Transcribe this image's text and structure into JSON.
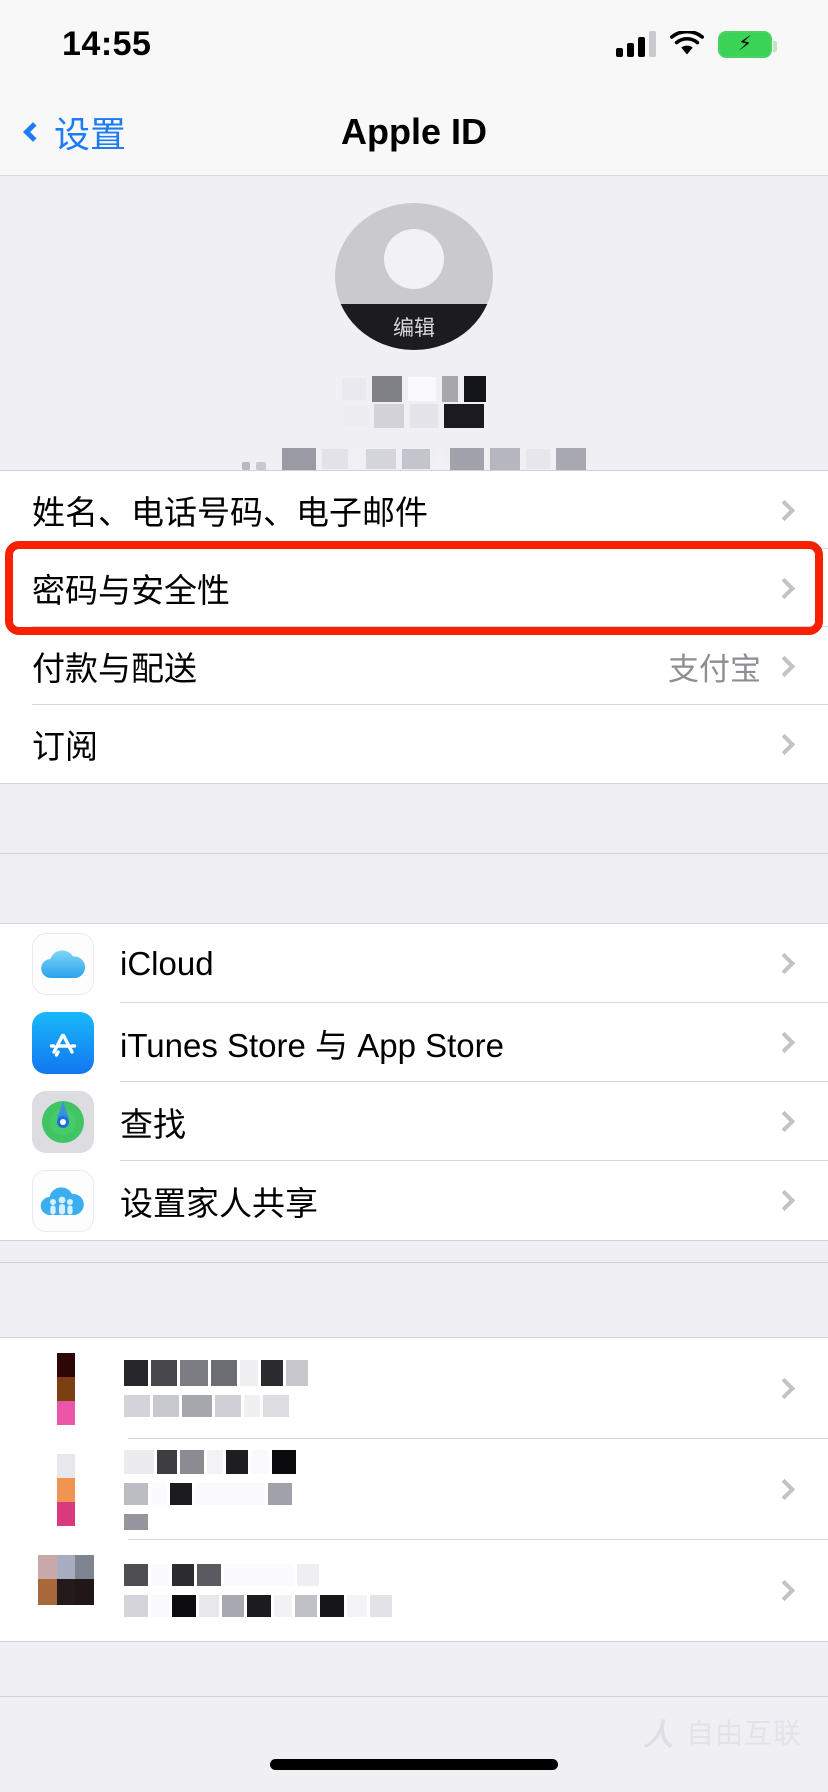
{
  "status_bar": {
    "time": "14:55",
    "signal_icon": "cellular-signal-icon",
    "signal_bars_filled": 3,
    "signal_bars_total": 4,
    "wifi_icon": "wifi-icon",
    "battery_icon": "battery-charging-icon",
    "battery_charging": true,
    "battery_color": "#3ad355",
    "bolt_glyph": "⚡"
  },
  "nav": {
    "back_label": "设置",
    "back_icon": "chevron-left-icon",
    "title": "Apple ID",
    "tint_color": "#1d7cf2"
  },
  "profile": {
    "avatar_icon": "person-placeholder-avatar",
    "edit_label": "编辑",
    "name_redacted": true,
    "email_redacted": true
  },
  "account_group": {
    "items": [
      {
        "label": "姓名、电话号码、电子邮件",
        "value": "",
        "chevron": "chevron-right-icon",
        "highlighted": false
      },
      {
        "label": "密码与安全性",
        "value": "",
        "chevron": "chevron-right-icon",
        "highlighted": true
      },
      {
        "label": "付款与配送",
        "value": "支付宝",
        "chevron": "chevron-right-icon",
        "highlighted": false
      },
      {
        "label": "订阅",
        "value": "",
        "chevron": "chevron-right-icon",
        "highlighted": false
      }
    ],
    "highlight_color": "#f52100"
  },
  "services_group": {
    "items": [
      {
        "label": "iCloud",
        "icon": "icloud-icon",
        "chevron": "chevron-right-icon"
      },
      {
        "label": "iTunes Store 与 App Store",
        "icon": "app-store-icon",
        "chevron": "chevron-right-icon"
      },
      {
        "label": "查找",
        "icon": "find-my-icon",
        "chevron": "chevron-right-icon"
      },
      {
        "label": "设置家人共享",
        "icon": "family-sharing-icon",
        "chevron": "chevron-right-icon"
      }
    ]
  },
  "devices_group": {
    "items": [
      {
        "label": "",
        "sublabel": "",
        "redacted": true,
        "chevron": "chevron-right-icon"
      },
      {
        "label": "",
        "sublabel": "",
        "redacted": true,
        "chevron": "chevron-right-icon"
      },
      {
        "label": "",
        "sublabel": "",
        "redacted": true,
        "chevron": "chevron-right-icon"
      }
    ]
  },
  "watermark": {
    "mark": "人",
    "text": "自由互联"
  }
}
